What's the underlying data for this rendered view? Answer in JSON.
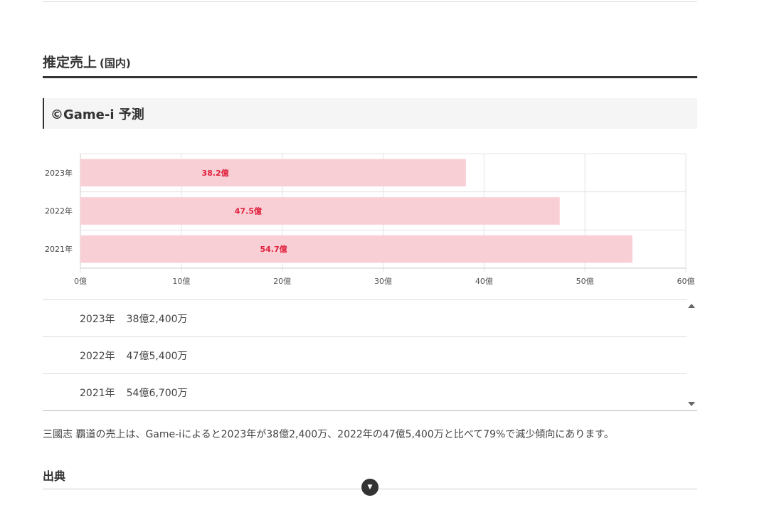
{
  "section": {
    "title": "推定売上",
    "subtitle": "(国内)"
  },
  "source": {
    "label": "©Game-i 予測"
  },
  "chart_data": {
    "type": "bar",
    "orientation": "horizontal",
    "categories": [
      "2023年",
      "2022年",
      "2021年"
    ],
    "values": [
      38.2,
      47.5,
      54.7
    ],
    "data_labels": [
      "38.2億",
      "47.5億",
      "54.7億"
    ],
    "x_ticks": [
      "0億",
      "10億",
      "20億",
      "30億",
      "40億",
      "50億",
      "60億"
    ],
    "xlim": [
      0,
      60
    ],
    "grid": true,
    "bar_color": "#f9cfd6",
    "label_color": "#e0203c"
  },
  "rows": [
    {
      "year": "2023年",
      "value": "38億2,400万"
    },
    {
      "year": "2022年",
      "value": "47億5,400万"
    },
    {
      "year": "2021年",
      "value": "54億6,700万"
    }
  ],
  "summary": "三國志 覇道の売上は、Game-iによると2023年が38億2,400万、2022年の47億5,400万と比べて79%で減少傾向にあります。",
  "citation": {
    "title": "出典"
  },
  "icons": {
    "float_button": "chevron-down-icon"
  }
}
